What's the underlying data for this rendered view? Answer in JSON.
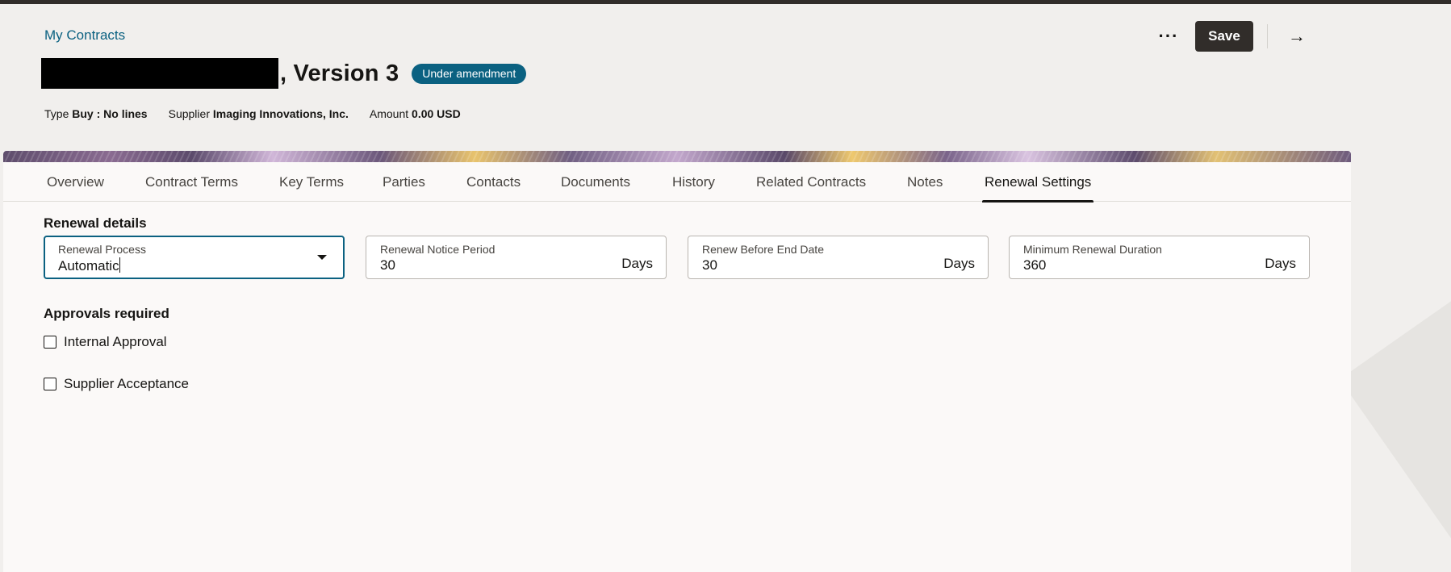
{
  "header": {
    "breadcrumb": "My Contracts",
    "title_suffix": ", Version 3",
    "status_badge": "Under amendment",
    "meta": [
      {
        "label": "Type",
        "value": "Buy : No lines"
      },
      {
        "label": "Supplier",
        "value": "Imaging Innovations, Inc."
      },
      {
        "label": "Amount",
        "value": "0.00 USD"
      }
    ],
    "more_label": "···",
    "save_label": "Save",
    "next_label": "→"
  },
  "tabs": [
    {
      "label": "Overview"
    },
    {
      "label": "Contract Terms"
    },
    {
      "label": "Key Terms"
    },
    {
      "label": "Parties"
    },
    {
      "label": "Contacts"
    },
    {
      "label": "Documents"
    },
    {
      "label": "History"
    },
    {
      "label": "Related Contracts"
    },
    {
      "label": "Notes"
    },
    {
      "label": "Renewal Settings",
      "active": true
    }
  ],
  "renewal": {
    "section_title": "Renewal details",
    "fields": [
      {
        "label": "Renewal Process",
        "value": "Automatic"
      },
      {
        "label": "Renewal Notice Period",
        "value": "30",
        "suffix": "Days"
      },
      {
        "label": "Renew Before End Date",
        "value": "30",
        "suffix": "Days"
      },
      {
        "label": "Minimum Renewal Duration",
        "value": "360",
        "suffix": "Days"
      }
    ]
  },
  "approvals": {
    "section_title": "Approvals required",
    "items": [
      {
        "label": "Internal Approval",
        "checked": false
      },
      {
        "label": "Supplier Acceptance",
        "checked": false
      }
    ]
  },
  "colors": {
    "accent": "#0b6181",
    "save_button": "#312d2a",
    "page_bg": "#f1efed",
    "card_bg": "#fbf9f8"
  }
}
